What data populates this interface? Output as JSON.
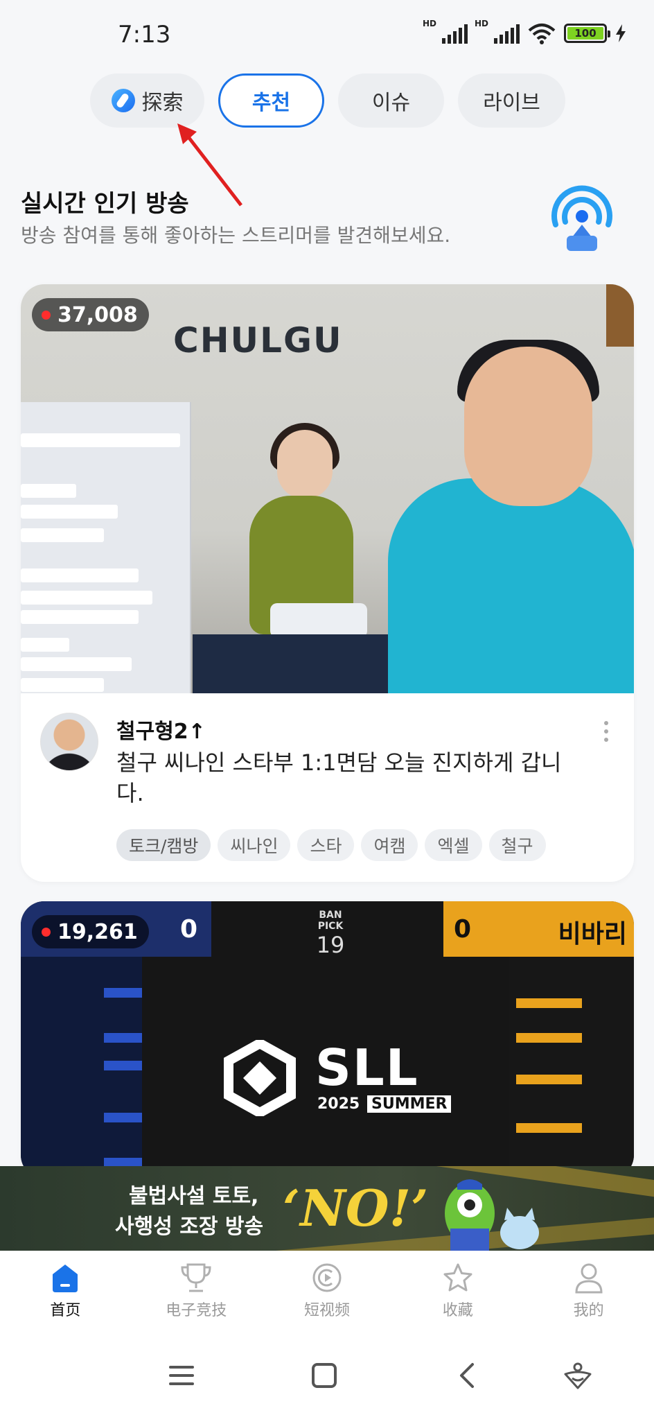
{
  "status_bar": {
    "time": "7:13",
    "signal_label_1": "HD",
    "signal_label_2": "HD",
    "battery": "100"
  },
  "top_tabs": [
    {
      "label": "探索",
      "icon": "compass-icon",
      "active": false
    },
    {
      "label": "추천",
      "active": true
    },
    {
      "label": "이슈",
      "active": false
    },
    {
      "label": "라이브",
      "active": false
    }
  ],
  "section": {
    "title": "실시간 인기 방송",
    "subtitle": "방송 참여를 통해 좋아하는 스트리머를 발견해보세요.",
    "icon": "live-broadcast-icon"
  },
  "streams": [
    {
      "viewers": "37,008",
      "thumbnail_text": "CHULGU",
      "streamer": "철구형2↑",
      "title": "철구 씨나인 스타부 1:1면담 오늘 진지하게 갑니다.",
      "tags": [
        "토크/캠방",
        "씨나인",
        "스타",
        "여캠",
        "엑셀",
        "철구"
      ]
    },
    {
      "viewers": "19,261",
      "scoreboard": {
        "left_score": "0",
        "right_score": "0",
        "right_team": "비바리",
        "ban_pick_label": "BAN PICK",
        "ban_pick_number": "19"
      },
      "logo_text": "SLL",
      "logo_year": "2025",
      "logo_season": "SUMMER"
    }
  ],
  "ad_banner": {
    "line1": "불법사설 토토,",
    "line2": "사행성 조장 방송",
    "slogan": "‘NO!’"
  },
  "bottom_nav": [
    {
      "label": "首页",
      "icon": "home-icon",
      "active": true
    },
    {
      "label": "电子竞技",
      "icon": "trophy-icon",
      "active": false
    },
    {
      "label": "短视频",
      "icon": "short-video-icon",
      "active": false
    },
    {
      "label": "收藏",
      "icon": "star-icon",
      "active": false
    },
    {
      "label": "我的",
      "icon": "profile-icon",
      "active": false
    }
  ],
  "colors": {
    "accent": "#1a73e8",
    "live_dot": "#ff2d2d",
    "ad_highlight": "#f5d23a"
  }
}
